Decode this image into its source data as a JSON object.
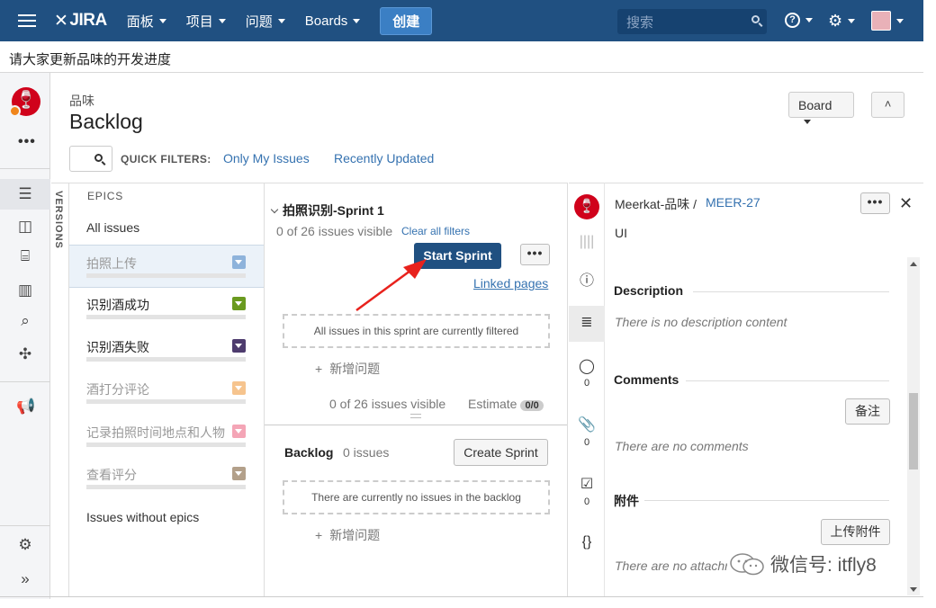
{
  "topnav": {
    "logo": "JIRA",
    "menus": [
      "面板",
      "项目",
      "问题",
      "Boards"
    ],
    "create_label": "创建",
    "search_placeholder": "搜索",
    "help_icon": "help-icon",
    "settings_icon": "gear-icon",
    "brand_color": "#205081"
  },
  "announcement": "请大家更新品味的开发进度",
  "header": {
    "project": "品味",
    "title": "Backlog",
    "board_label": "Board",
    "quick_filters_label": "QUICK FILTERS:",
    "quick_filters": [
      "Only My Issues",
      "Recently Updated"
    ]
  },
  "versions_label": "VERSIONS",
  "epics": {
    "header": "EPICS",
    "all_issues": "All issues",
    "items": [
      {
        "label": "拍照上传",
        "color": "#8eb3db",
        "selected": true,
        "muted": true
      },
      {
        "label": "识别酒成功",
        "color": "#6a9a1f",
        "selected": false,
        "muted": false
      },
      {
        "label": "识别酒失败",
        "color": "#4e3c6e",
        "selected": false,
        "muted": false
      },
      {
        "label": "酒打分评论",
        "color": "#f6c48e",
        "selected": false,
        "muted": true
      },
      {
        "label": "记录拍照时间地点和人物",
        "color": "#f4a5b6",
        "selected": false,
        "muted": true
      },
      {
        "label": "查看评分",
        "color": "#b3a08a",
        "selected": false,
        "muted": true
      }
    ],
    "without_epics": "Issues without epics"
  },
  "sprint": {
    "name": "拍照识别-Sprint 1",
    "visible_text": "0 of 26 issues visible",
    "clear_filters": "Clear all filters",
    "start_label": "Start Sprint",
    "more_label": "•••",
    "linked_pages": "Linked pages",
    "filtered_msg": "All issues in this sprint are currently filtered",
    "add_issue": "新增问题",
    "footer_visible": "0 of 26 issues visible",
    "estimate_label": "Estimate",
    "estimate_value": "0/0"
  },
  "backlog": {
    "title": "Backlog",
    "count": "0 issues",
    "create_sprint": "Create Sprint",
    "empty_msg": "There are currently no issues in the backlog",
    "add_issue": "新增问题"
  },
  "detail": {
    "breadcrumb": "Meerkat-品味 /",
    "issue_key": "MEER-27",
    "summary": "UI",
    "more_label": "•••",
    "close_label": "✕",
    "description_h": "Description",
    "description_empty": "There is no description content",
    "comments_h": "Comments",
    "comment_btn": "备注",
    "comments_empty": "There are no comments",
    "attachments_h": "附件",
    "upload_btn": "上传附件",
    "attachments_empty": "There are no attachments",
    "side_counts": [
      "0",
      "0",
      "0"
    ]
  },
  "watermark": "微信号: itfly8"
}
